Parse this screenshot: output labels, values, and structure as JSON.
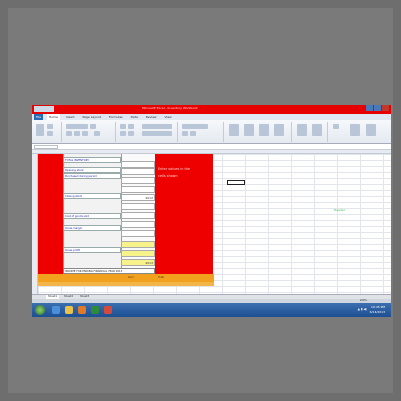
{
  "window": {
    "title": "Microsoft Excel - Inventory Workbook",
    "tabs": [
      "File",
      "Home",
      "Insert",
      "Page Layout",
      "Formulas",
      "Data",
      "Review",
      "View"
    ]
  },
  "formula_bar": {
    "name_box": "A1"
  },
  "sheet": {
    "header_cell": "TOTAL INVENTORY",
    "rows": [
      {
        "label": "Opening stock",
        "sublabel": "Purchased during period",
        "value": ""
      },
      {
        "label": "",
        "value": ""
      },
      {
        "label": "",
        "value": ""
      },
      {
        "label": "Closing stock",
        "value": "2012"
      },
      {
        "label": "",
        "value": ""
      },
      {
        "label": "Cost of goods sold",
        "value": ""
      },
      {
        "label": "Gross margin",
        "value": ""
      },
      {
        "label": "",
        "value": ""
      },
      {
        "label": "Gross profit",
        "value": ""
      },
      {
        "label": "",
        "value": "2013"
      }
    ],
    "right_notes": [
      "Enter values in the",
      "cells shown"
    ],
    "footnote": "INCOME FOR ENDING FINANCIAL YEAR 2013",
    "orange_labels": [
      "Sum",
      "Total"
    ],
    "green_text": "Header"
  },
  "sheet_tabs": [
    "Sheet1",
    "Sheet2",
    "Sheet3"
  ],
  "status": {
    "zoom": "100%"
  },
  "taskbar": {
    "time": "10:45 PM",
    "date": "6/14/2013"
  },
  "colors": {
    "accent_red": "#ee0000",
    "accent_orange": "#f1a11e",
    "cell_yellow": "#f7f28a"
  },
  "icons": [
    "start-orb-icon",
    "ie-icon",
    "folder-icon",
    "media-icon",
    "excel-icon",
    "chrome-icon"
  ]
}
